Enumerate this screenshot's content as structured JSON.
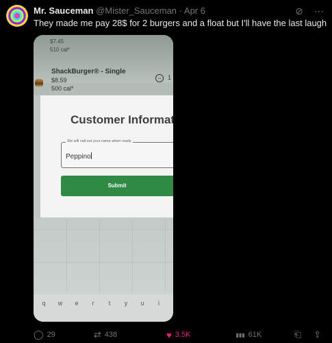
{
  "author": {
    "name": "Mr. Sauceman",
    "handle": "@Mister_Sauceman",
    "separator": "·",
    "date": "Apr 6"
  },
  "top_icons": {
    "grok": "⊘",
    "more": "⋯"
  },
  "tweet": {
    "text": "They made me pay 28$ for 2 burgers and a float but I'll have the last laugh"
  },
  "photo": {
    "item1": {
      "price": "$7.45",
      "cal": "510 cal*"
    },
    "item2": {
      "title": "ShackBurger® - Single",
      "price": "$8.59",
      "cal": "500 cal*"
    },
    "qty": "1",
    "minus": "−",
    "modal": {
      "title": "Customer Informati",
      "field_label": "We will call out your name when ready",
      "field_value": "Peppino",
      "submit": "Submit"
    },
    "keyboard": {
      "keys": [
        "q",
        "w",
        "e",
        "r",
        "t",
        "y",
        "u",
        "i"
      ]
    }
  },
  "actions": {
    "replies": "29",
    "reposts": "438",
    "likes": "3.5K",
    "views": "61K",
    "icons": {
      "reply": "◯",
      "repost": "⇄",
      "like": "♥",
      "views": "▮▮▮",
      "bookmark": "⎗",
      "share": "⇪"
    }
  },
  "colors": {
    "like": "#f91880",
    "submit": "#2f8a44",
    "muted": "#71767b"
  }
}
